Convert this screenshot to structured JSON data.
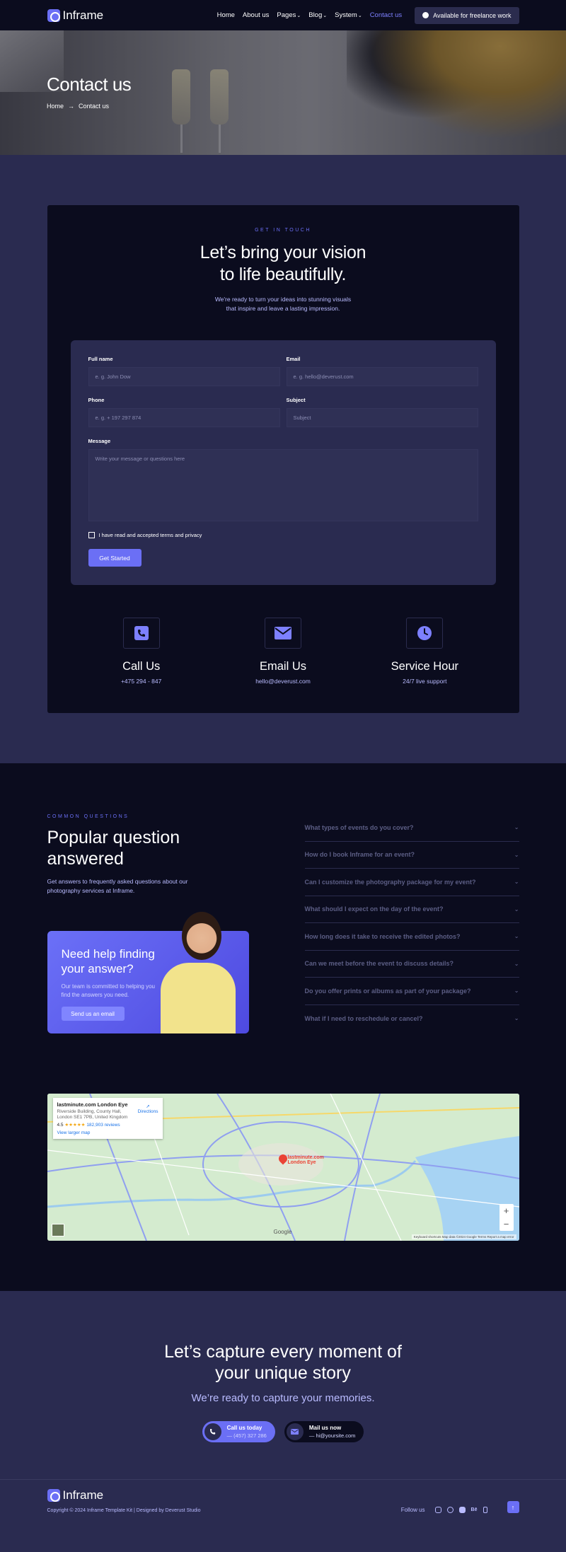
{
  "brand": {
    "name": "Inframe"
  },
  "nav": {
    "links": [
      "Home",
      "About us",
      "Pages",
      "Blog",
      "System",
      "Contact us"
    ],
    "cta": "Available for freelance work"
  },
  "hero": {
    "title": "Contact us",
    "breadcrumb": [
      "Home",
      "Contact us"
    ]
  },
  "contact": {
    "eyebrow": "GET IN TOUCH",
    "title_line1": "Let’s bring your vision",
    "title_line2": "to life beautifully.",
    "lead": "We're ready to turn your ideas into stunning visuals that inspire and leave a lasting impression.",
    "form": {
      "full_name_label": "Full name",
      "full_name_placeholder": "e. g. John Dow",
      "email_label": "Email",
      "email_placeholder": "e. g. hello@deverust.com",
      "phone_label": "Phone",
      "phone_placeholder": "e. g. + 197 297 874",
      "subject_label": "Subject",
      "subject_placeholder": "Subject",
      "message_label": "Message",
      "message_placeholder": "Write your message or questions here",
      "terms": "I have read and accepted terms and privacy",
      "submit": "Get Started"
    },
    "info": [
      {
        "title": "Call Us",
        "value": "+475 294 - 847",
        "icon": "phone-icon"
      },
      {
        "title": "Email Us",
        "value": "hello@deverust.com",
        "icon": "mail-icon"
      },
      {
        "title": "Service Hour",
        "value": "24/7 live support",
        "icon": "clock-icon"
      }
    ]
  },
  "faq": {
    "eyebrow": "COMMON QUESTIONS",
    "title_line1": "Popular question",
    "title_line2": "answered",
    "lead": "Get answers to frequently asked questions about our photography services at Inframe.",
    "help": {
      "title": "Need help finding your answer?",
      "text": "Our team is committed to helping you find the answers you need.",
      "button": "Send us an email"
    },
    "questions": [
      "What types of events do you cover?",
      "How do I book Inframe for an event?",
      "Can I customize the photography package for my event?",
      "What should I expect on the day of the event?",
      "How long does it take to receive the edited photos?",
      "Can we meet before the event to discuss details?",
      "Do you offer prints or albums as part of your package?",
      "What if I need to reschedule or cancel?"
    ]
  },
  "map": {
    "place": "lastminute.com London Eye",
    "address": "Riverside Building, County Hall, London SE1 7PB, United Kingdom",
    "rating": "4.5",
    "stars": "★★★★★",
    "reviews": "182,903 reviews",
    "directions": "Directions",
    "larger": "View larger map",
    "pin_label": "lastminute.com London Eye",
    "attribution": "Keyboard shortcuts   Map data ©2024 Google   Terms   Report a map error",
    "google": "Google"
  },
  "cta": {
    "title_line1": "Let’s capture every moment of",
    "title_line2": "your unique story",
    "sub": "We’re ready to capture your memories.",
    "call_label": "Call us today",
    "call_value": "— (457) 327 286",
    "mail_label": "Mail us now",
    "mail_value": "— hi@yoursite.com"
  },
  "footer": {
    "copyright": "Copyright © 2024 Inframe Template Kit | Designed by Deverust Studio",
    "follow": "Follow us"
  },
  "colors": {
    "accent": "#6b6ff5",
    "bg_dark": "#0b0c1e",
    "bg_mid": "#2a2b50"
  }
}
